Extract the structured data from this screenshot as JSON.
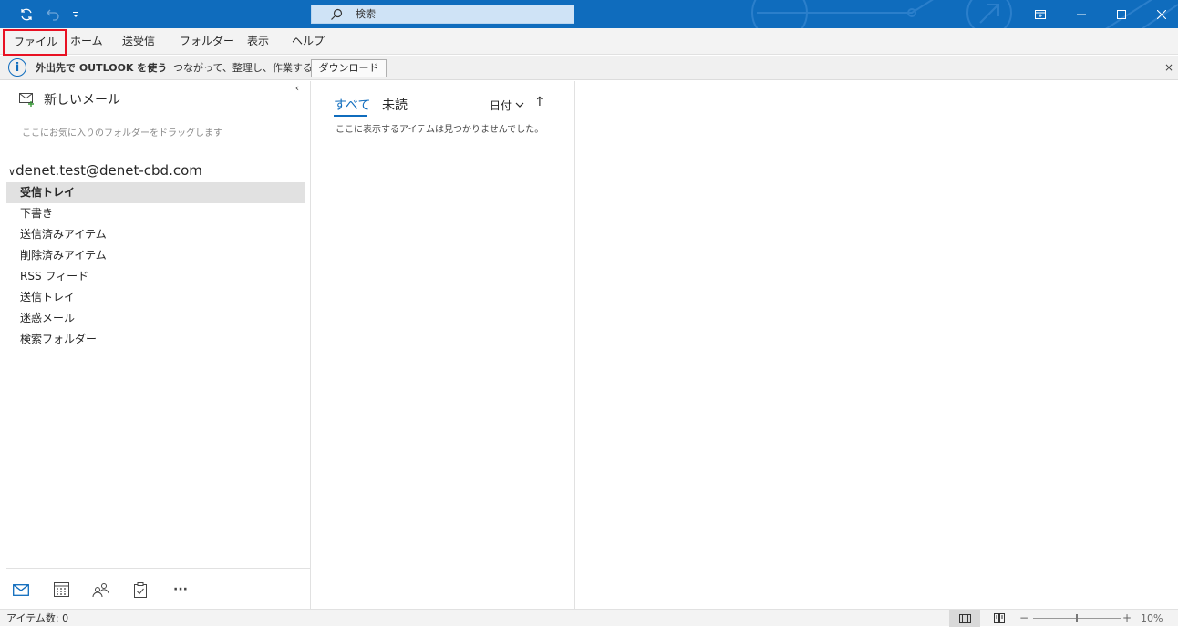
{
  "titlebar": {
    "search_placeholder": "検索",
    "icons": [
      "sync-icon",
      "undo-icon",
      "customize-qat-icon",
      "ribbon-display-icon",
      "minimize-icon",
      "maximize-icon",
      "close-icon"
    ]
  },
  "menu": {
    "items": [
      {
        "label": "ファイル"
      },
      {
        "label": "ホーム"
      },
      {
        "label": "送受信"
      },
      {
        "label": "フォルダー"
      },
      {
        "label": "表示"
      },
      {
        "label": "ヘルプ"
      }
    ]
  },
  "infobar": {
    "title": "外出先で OUTLOOK を使う",
    "text": "つながって、整理し、作業する",
    "button": "ダウンロード",
    "close": "×"
  },
  "folderpane": {
    "new_mail": "新しいメール",
    "favorites_hint": "ここにお気に入りのフォルダーをドラッグします",
    "account": "denet.test@denet-cbd.com",
    "folders": [
      {
        "label": "受信トレイ",
        "selected": true
      },
      {
        "label": "下書き"
      },
      {
        "label": "送信済みアイテム"
      },
      {
        "label": "削除済みアイテム"
      },
      {
        "label": "RSS フィード"
      },
      {
        "label": "送信トレイ"
      },
      {
        "label": "迷惑メール"
      },
      {
        "label": "検索フォルダー"
      }
    ],
    "nav_more": "···"
  },
  "msglist": {
    "tab_all": "すべて",
    "tab_unread": "未読",
    "sort_label": "日付",
    "sort_direction": "↑",
    "empty_message": "ここに表示するアイテムは見つかりませんでした。"
  },
  "statusbar": {
    "item_count": "アイテム数: 0",
    "zoom_minus": "−",
    "zoom_plus": "+",
    "zoom_level": "10%"
  },
  "colors": {
    "accent": "#0f6cbd",
    "highlight_border": "#e81123"
  }
}
